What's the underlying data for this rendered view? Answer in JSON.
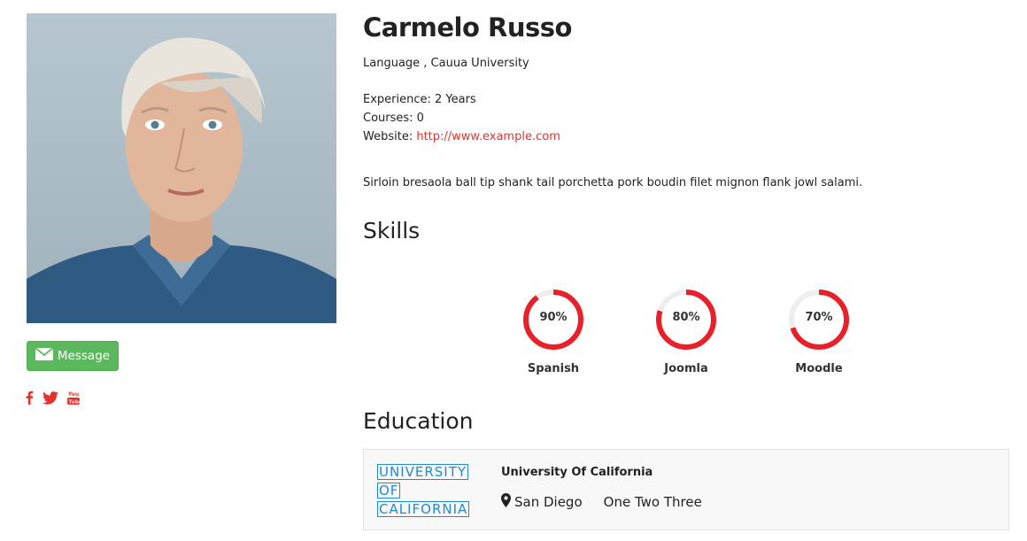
{
  "profile": {
    "name": "Carmelo Russo",
    "subtitle": "Language , Cauua University",
    "experience": "Experience: 2 Years",
    "courses": "Courses: 0",
    "website_label": "Website:",
    "website_url": "http://www.example.com",
    "bio": "Sirloin bresaola ball tip shank tail porchetta pork boudin filet mignon flank jowl salami."
  },
  "actions": {
    "message_label": "Message"
  },
  "social": [
    "facebook-icon",
    "twitter-icon",
    "youtube-icon"
  ],
  "skills": {
    "title": "Skills",
    "items": [
      {
        "label": "Spanish",
        "percent": 90,
        "text": "90%"
      },
      {
        "label": "Joomla",
        "percent": 80,
        "text": "80%"
      },
      {
        "label": "Moodle",
        "percent": 70,
        "text": "70%"
      }
    ]
  },
  "education": {
    "title": "Education",
    "logo_lines": [
      "UNIVERSITY",
      "OF",
      "CALIFORNIA"
    ],
    "school": "University Of California",
    "location": "San Diego",
    "detail": "One Two Three"
  },
  "colors": {
    "accent": "#e5322d",
    "ring": "#e8202a",
    "ring_track": "#eeeeee",
    "button": "#5cb85c",
    "logo_blue": "#1f8bd1"
  }
}
